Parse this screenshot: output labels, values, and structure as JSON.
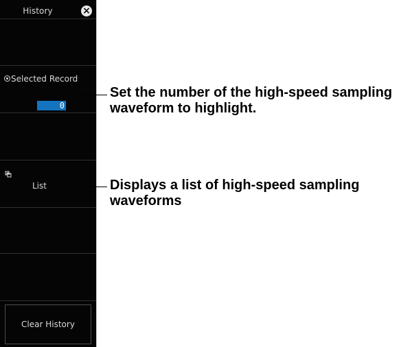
{
  "panel": {
    "title": "History",
    "close_icon": "close-icon",
    "selected_record": {
      "label": "Selected Record",
      "value": "0",
      "icon": "radio-icon"
    },
    "list": {
      "label": "List",
      "icon": "list-icon"
    },
    "clear_history": {
      "label": "Clear History"
    }
  },
  "annotations": {
    "selected_record": "Set the number of the high-speed sampling waveform to highlight.",
    "list": "Displays a list of high-speed sampling waveforms"
  },
  "colors": {
    "panel_background": "#050505",
    "input_blue": "#1474bd",
    "text_light": "#d8d8d8"
  }
}
